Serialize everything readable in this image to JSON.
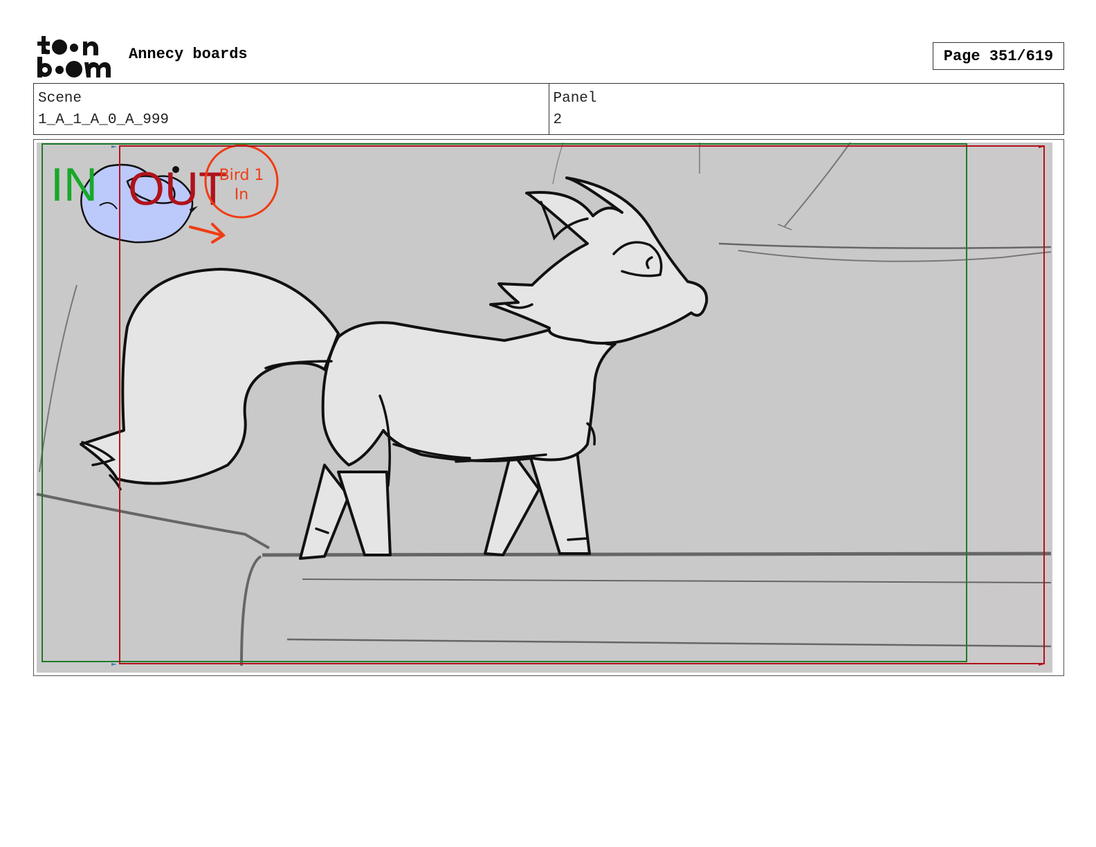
{
  "header": {
    "brand_logo": "toon boom",
    "doc_title": "Annecy boards",
    "page_label": "Page 351/619"
  },
  "info": {
    "scene_label": "Scene",
    "scene_value": "1_A_1_A_0_A_999",
    "panel_label": "Panel",
    "panel_value": "2"
  },
  "panel_image": {
    "in_label": "IN",
    "out_label": "OUT",
    "note": "Bird 1 In",
    "colors": {
      "background": "#c9c9c9",
      "in_frame": "#1e7a2a",
      "out_frame": "#b0121b",
      "annotation": "#f03c14",
      "bird": "#bcc9fb"
    }
  }
}
